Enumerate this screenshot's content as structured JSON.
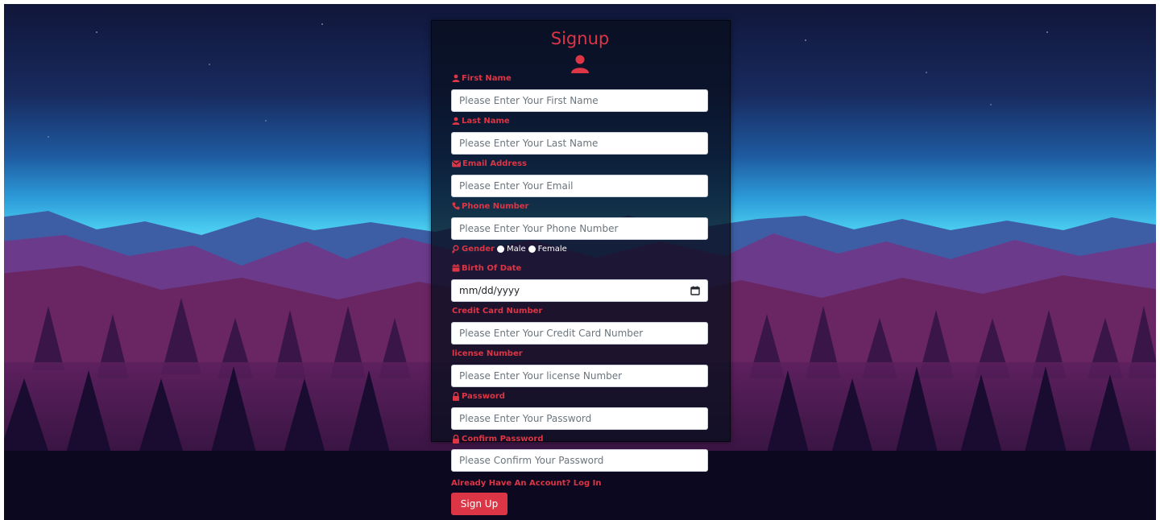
{
  "form": {
    "title": "Signup",
    "fields": {
      "first_name": {
        "label": "First Name",
        "placeholder": "Please Enter Your First Name"
      },
      "last_name": {
        "label": "Last Name",
        "placeholder": "Please Enter Your Last Name"
      },
      "email": {
        "label": "Email Address",
        "placeholder": "Please Enter Your Email"
      },
      "phone": {
        "label": "Phone Number",
        "placeholder": "Please Enter Your Phone Number"
      },
      "birth_date": {
        "label": "Birth Of Date",
        "value": "mm/dd/yyyy"
      },
      "credit_card": {
        "label": "Credit Card Number",
        "placeholder": "Please Enter Your Credit Card Number"
      },
      "license": {
        "label": "license Number",
        "placeholder": "Please Enter Your license Number"
      },
      "password": {
        "label": "Password",
        "placeholder": "Please Enter Your Password"
      },
      "confirm_password": {
        "label": "Confirm Password",
        "placeholder": "Please Confirm Your Password"
      }
    },
    "gender": {
      "label": "Gender",
      "options": [
        "Male",
        "Female"
      ]
    },
    "login_link": "Already Have An Account? Log In",
    "submit_label": "Sign Up"
  },
  "colors": {
    "accent": "#dc3545",
    "panel": "#0b1224",
    "sky_top": "#0e1436",
    "sky_horizon": "#3fc6f0"
  },
  "icons": [
    "user-icon",
    "envelope-icon",
    "phone-icon",
    "venus-icon",
    "calendar-icon",
    "lock-icon"
  ]
}
